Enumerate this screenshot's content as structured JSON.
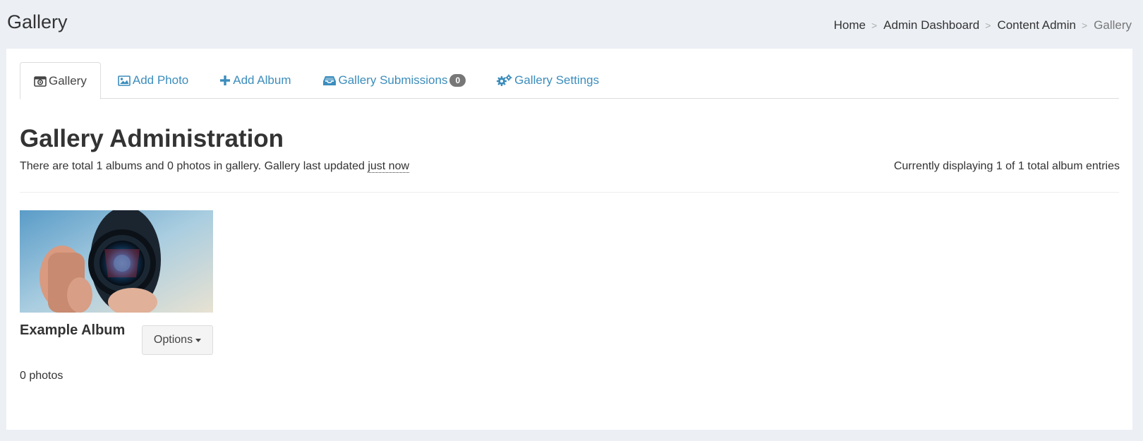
{
  "header": {
    "title": "Gallery",
    "breadcrumb": [
      "Home",
      "Admin Dashboard",
      "Content Admin",
      "Gallery"
    ]
  },
  "tabs": [
    {
      "label": "Gallery",
      "icon": "camera-retro-icon",
      "active": true
    },
    {
      "label": "Add Photo",
      "icon": "picture-icon",
      "active": false
    },
    {
      "label": "Add Album",
      "icon": "plus-icon",
      "active": false
    },
    {
      "label": "Gallery Submissions",
      "icon": "inbox-icon",
      "badge": "0",
      "active": false
    },
    {
      "label": "Gallery Settings",
      "icon": "gears-icon",
      "active": false
    }
  ],
  "main": {
    "heading": "Gallery Administration",
    "summary_prefix": "There are total 1 albums and 0 photos in gallery. Gallery last updated ",
    "summary_time": "just now",
    "display_info": "Currently displaying 1 of 1 total album entries"
  },
  "albums": [
    {
      "title": "Example Album",
      "options_label": "Options",
      "photo_count": "0 photos"
    }
  ],
  "colors": {
    "link": "#3c8dbc",
    "background": "#ecf0f5",
    "badge": "#777777"
  }
}
